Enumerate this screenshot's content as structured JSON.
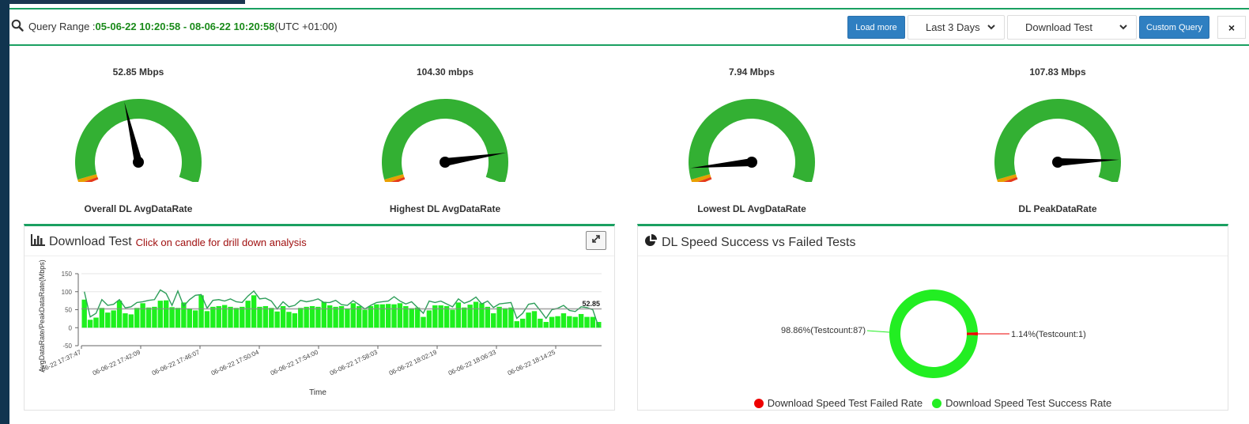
{
  "query": {
    "label": "Query Range :",
    "range": "05-06-22 10:20:58 - 08-06-22 10:20:58",
    "tz": "(UTC +01:00)"
  },
  "controls": {
    "load_more": "Load more",
    "range_select": "Last 3 Days",
    "test_select": "Download Test",
    "custom_query": "Custom Query",
    "close": "×"
  },
  "gauges": [
    {
      "value_text": "52.85 Mbps",
      "label": "Overall DL AvgDataRate",
      "value": 52.85
    },
    {
      "value_text": "104.30 mbps",
      "label": "Highest DL AvgDataRate",
      "value": 104.3
    },
    {
      "value_text": "7.94 Mbps",
      "label": "Lowest DL AvgDataRate",
      "value": 7.94
    },
    {
      "value_text": "107.83 Mbps",
      "label": "DL PeakDataRate",
      "value": 107.83
    }
  ],
  "colors": {
    "accent": "#1aa061",
    "gauge_green": "#33b033",
    "bar_green": "#1ef01e",
    "fail_red": "#ee0000",
    "success_green": "#22ee22"
  },
  "download_panel": {
    "title": "Download Test",
    "subtitle": "Click on candle for drill down analysis"
  },
  "success_panel": {
    "title": "DL Speed Success vs Failed Tests"
  },
  "chart_data": [
    {
      "type": "bar",
      "title": "",
      "xlabel": "Time",
      "ylabel": "AvgDataRate/PeakDataRate(Mbps)",
      "ylim": [
        -50,
        150
      ],
      "yticks": [
        -50,
        0,
        50,
        100,
        150
      ],
      "xtick_labels": [
        "06-22 17:37:47",
        "06-06-22 17:42:09",
        "06-06-22 17:46:07",
        "06-06-22 17:50:04",
        "06-06-22 17:54:00",
        "06-06-22 17:58:03",
        "06-06-22 18:02:19",
        "06-06-22 18:06:33",
        "06-06-22 18:14:25"
      ],
      "average_line": 52.85,
      "average_label": "52.85",
      "series": [
        {
          "values": [
            78,
            22,
            28,
            55,
            42,
            48,
            75,
            40,
            37,
            55,
            68,
            56,
            58,
            75,
            76,
            57,
            55,
            70,
            53,
            48,
            90,
            46,
            58,
            60,
            63,
            58,
            55,
            58,
            75,
            90,
            58,
            60,
            55,
            45,
            60,
            44,
            40,
            55,
            58,
            60,
            58,
            72,
            62,
            58,
            60,
            52,
            68,
            60,
            50,
            60,
            65,
            65,
            66,
            65,
            68,
            60,
            54,
            56,
            30,
            48,
            62,
            62,
            60,
            50,
            70,
            56,
            64,
            72,
            68,
            58,
            40,
            58,
            54,
            56,
            18,
            25,
            42,
            46,
            25,
            16,
            30,
            32,
            40,
            32,
            30,
            38,
            30,
            30,
            16
          ]
        },
        {
          "values": [
            100,
            30,
            40,
            78,
            62,
            65,
            78,
            55,
            58,
            70,
            72,
            76,
            78,
            105,
            95,
            62,
            102,
            60,
            78,
            90,
            92,
            54,
            76,
            78,
            74,
            80,
            72,
            70,
            88,
            102,
            80,
            82,
            74,
            52,
            72,
            58,
            62,
            76,
            72,
            75,
            80,
            70,
            70,
            76,
            64,
            62,
            75,
            64,
            52,
            62,
            70,
            72,
            74,
            86,
            74,
            66,
            72,
            56,
            40,
            74,
            70,
            74,
            66,
            58,
            80,
            68,
            74,
            85,
            66,
            74,
            56,
            66,
            68,
            70,
            26,
            40,
            65,
            68,
            48,
            26,
            50,
            54,
            62,
            48,
            45,
            58,
            56,
            50,
            2
          ]
        }
      ]
    },
    {
      "type": "pie",
      "labels": [
        "Download Speed Test Failed Rate",
        "Download Speed Test Success Rate"
      ],
      "values": [
        1.14,
        98.86
      ],
      "counts": [
        1,
        87
      ],
      "data_labels": [
        "1.14%(Testcount:1)",
        "98.86%(Testcount:87)"
      ],
      "colors": [
        "#ee0000",
        "#22ee22"
      ],
      "legend": "bottom"
    }
  ]
}
